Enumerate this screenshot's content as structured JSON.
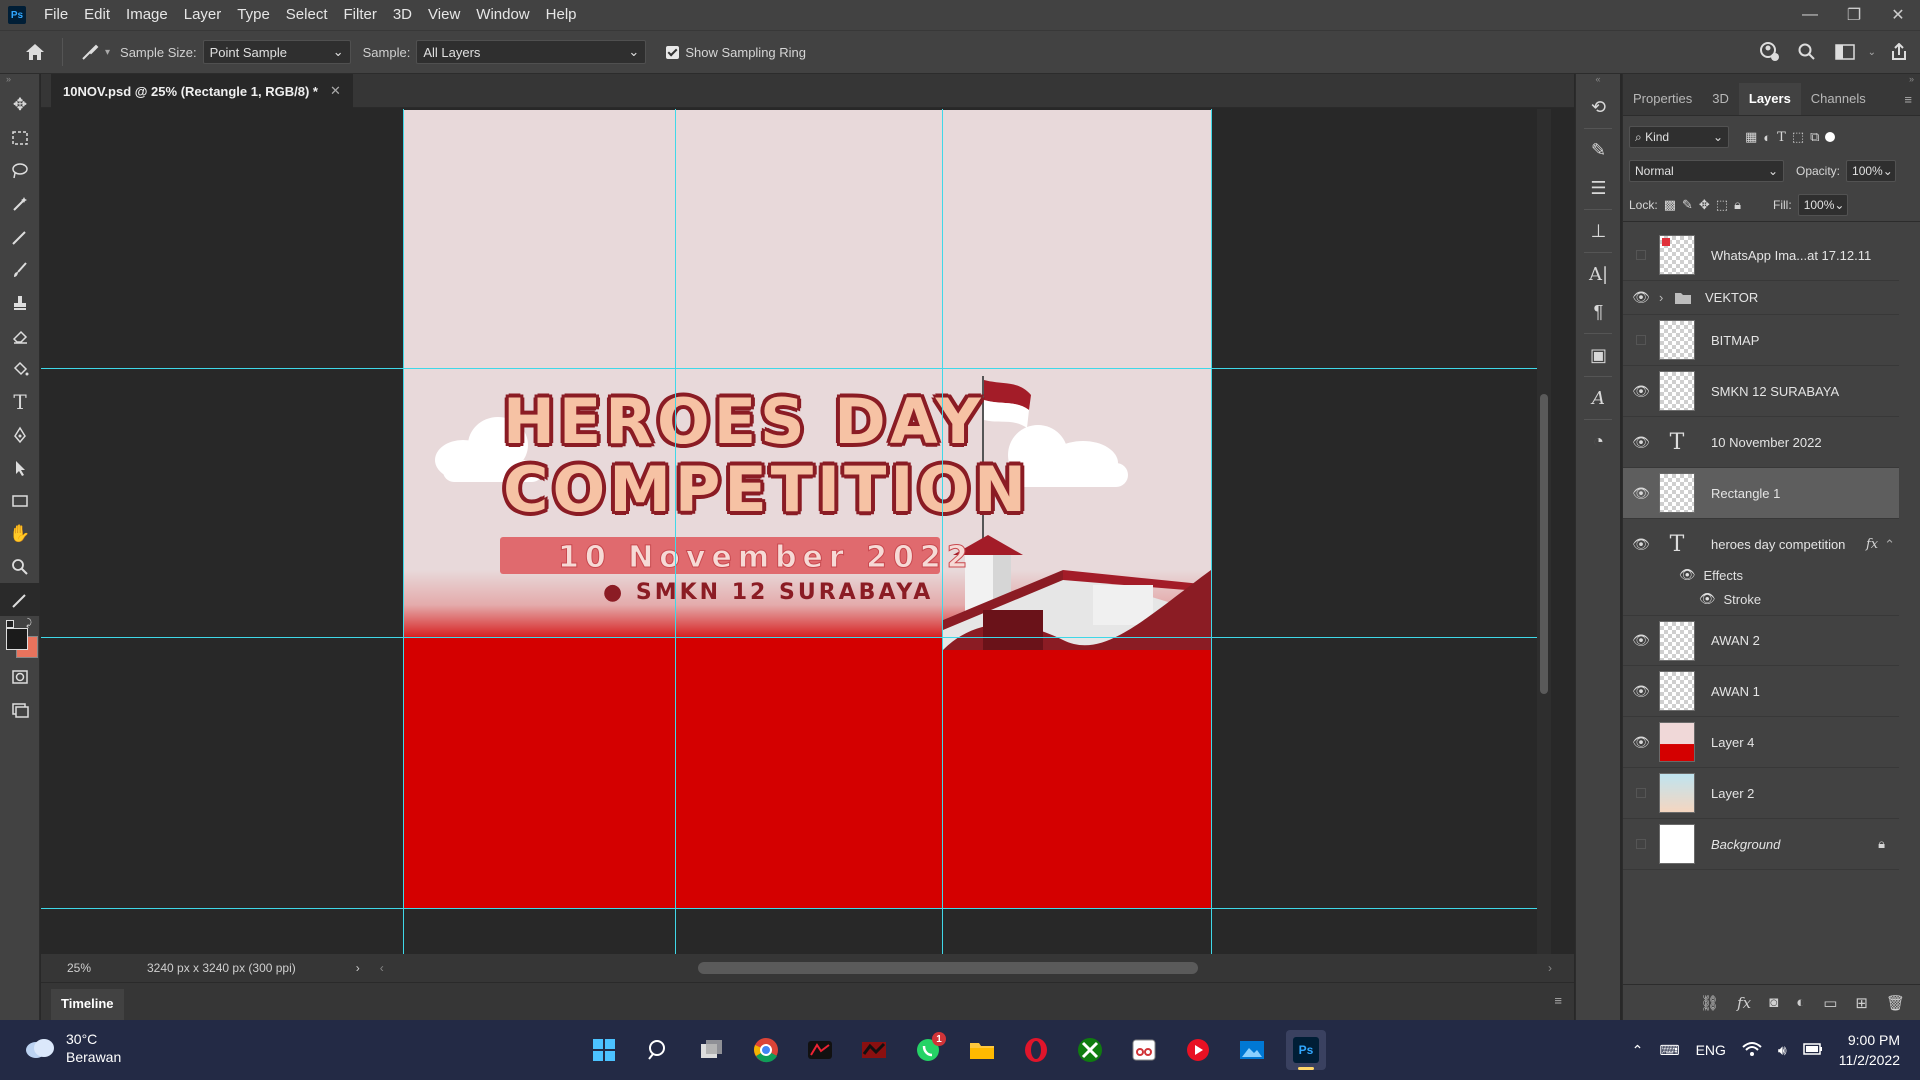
{
  "app": {
    "logo": "Ps"
  },
  "menu": [
    "File",
    "Edit",
    "Image",
    "Layer",
    "Type",
    "Select",
    "Filter",
    "3D",
    "View",
    "Window",
    "Help"
  ],
  "options": {
    "sample_size_label": "Sample Size:",
    "sample_size_value": "Point Sample",
    "sample_label": "Sample:",
    "sample_value": "All Layers",
    "show_ring_label": "Show Sampling Ring"
  },
  "document": {
    "tab_title": "10NOV.psd @ 25% (Rectangle 1, RGB/8) *",
    "zoom": "25%",
    "dimensions": "3240 px x 3240 px (300 ppi)"
  },
  "artwork": {
    "title_line1": "HEROES DAY",
    "title_line2": "COMPETITION",
    "date": "10 November 2022",
    "school": "SMKN 12 SURABAYA"
  },
  "panel": {
    "tabs": [
      "Properties",
      "3D",
      "Layers",
      "Channels"
    ],
    "active_tab": "Layers",
    "filter_kind": "Kind",
    "blend_mode": "Normal",
    "opacity_label": "Opacity:",
    "opacity_value": "100%",
    "lock_label": "Lock:",
    "fill_label": "Fill:",
    "fill_value": "100%"
  },
  "layers": [
    {
      "name": "WhatsApp Ima...at 17.12.11",
      "visible": false,
      "type": "smart"
    },
    {
      "name": "VEKTOR",
      "visible": true,
      "type": "folder"
    },
    {
      "name": "BITMAP",
      "visible": false,
      "type": "pixel"
    },
    {
      "name": "SMKN 12 SURABAYA",
      "visible": true,
      "type": "pixel"
    },
    {
      "name": "10 November 2022",
      "visible": true,
      "type": "text"
    },
    {
      "name": "Rectangle 1",
      "visible": true,
      "type": "shape",
      "selected": true
    },
    {
      "name": "heroes day competition",
      "visible": true,
      "type": "text",
      "fx": "fx"
    },
    {
      "name": "AWAN 2",
      "visible": true,
      "type": "smart"
    },
    {
      "name": "AWAN 1",
      "visible": true,
      "type": "smart"
    },
    {
      "name": "Layer 4",
      "visible": true,
      "type": "pixel"
    },
    {
      "name": "Layer 2",
      "visible": false,
      "type": "pixel"
    },
    {
      "name": "Background",
      "visible": false,
      "type": "background"
    }
  ],
  "effects": {
    "label": "Effects",
    "stroke": "Stroke"
  },
  "timeline": {
    "label": "Timeline"
  },
  "taskbar": {
    "weather_temp": "30°C",
    "weather_desc": "Berawan",
    "language": "ENG",
    "time": "9:00 PM",
    "date": "11/2/2022",
    "whatsapp_badge": "1"
  },
  "colors": {
    "accent_guide": "#3fd8e8",
    "art_red": "#d40000",
    "art_pink": "#e8d9da",
    "title_fill": "#f6c2a4",
    "title_stroke": "#8b1c24"
  }
}
